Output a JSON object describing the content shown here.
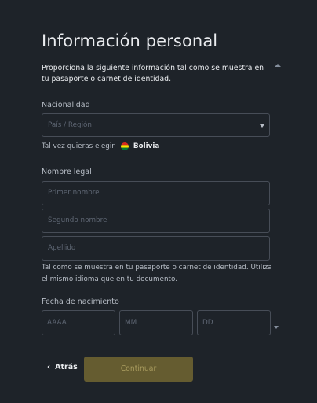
{
  "form": {
    "title": "Información personal",
    "subtitle": "Proporciona la siguiente información tal como se muestra en tu pasaporte o carnet de identidad."
  },
  "nationality": {
    "label": "Nacionalidad",
    "placeholder": "País / Región",
    "suggest_text": "Tal vez quieras elegir",
    "suggest_country": "Bolivia"
  },
  "legal_name": {
    "label": "Nombre legal",
    "first_placeholder": "Primer nombre",
    "middle_placeholder": "Segundo nombre",
    "last_placeholder": "Apellido",
    "hint": "Tal como se muestra en tu pasaporte o carnet de identidad. Utiliza el mismo idioma que en tu documento."
  },
  "birth_date": {
    "label": "Fecha de nacimiento",
    "year_placeholder": "AAAA",
    "month_placeholder": "MM",
    "day_placeholder": "DD"
  },
  "actions": {
    "back_label": "Atrás",
    "continue_label": "Continuar"
  },
  "colors": {
    "background": "#1e2329",
    "border": "#474d57",
    "continue_bg": "#655c30"
  }
}
